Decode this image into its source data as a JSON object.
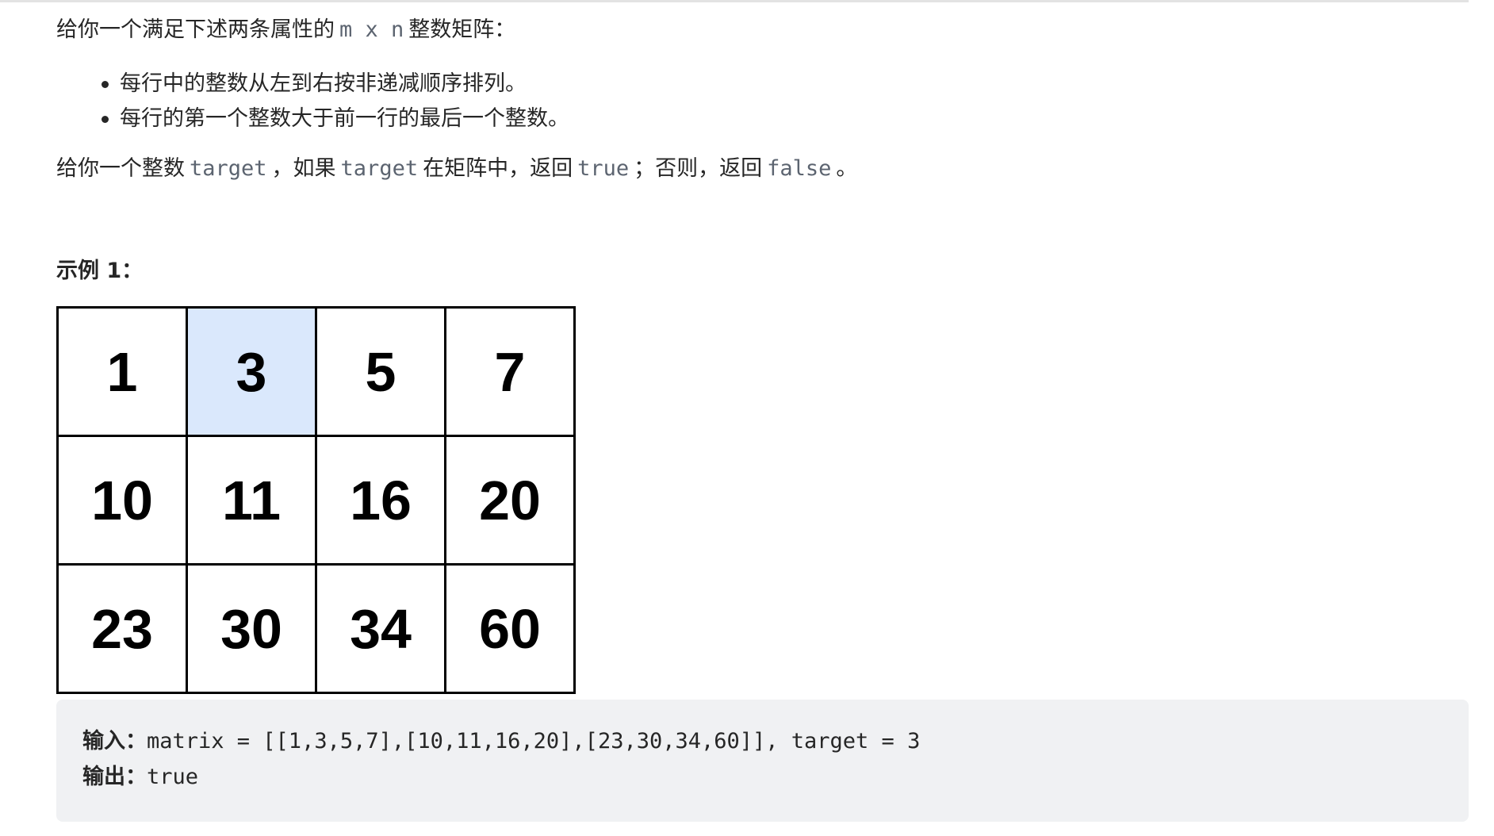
{
  "problem": {
    "intro_prefix": "给你一个满足下述两条属性的",
    "intro_code": "m x n",
    "intro_suffix": "整数矩阵：",
    "properties": [
      "每行中的整数从左到右按非递减顺序排列。",
      "每行的第一个整数大于前一行的最后一个整数。"
    ],
    "task": {
      "t1": "给你一个整数",
      "c1": "target",
      "t2": "，如果",
      "c2": "target",
      "t3": "在矩阵中，返回",
      "c3": "true",
      "t4": "；否则，返回",
      "c4": "false",
      "t5": "。"
    }
  },
  "example": {
    "heading": "示例 1：",
    "matrix": [
      [
        "1",
        "3",
        "5",
        "7"
      ],
      [
        "10",
        "11",
        "16",
        "20"
      ],
      [
        "23",
        "30",
        "34",
        "60"
      ]
    ],
    "highlight_value": "3",
    "highlight_color": "#dae8fc",
    "input_label": "输入：",
    "input_value": "matrix = [[1,3,5,7],[10,11,16,20],[23,30,34,60]], target = 3",
    "output_label": "输出：",
    "output_value": "true"
  }
}
